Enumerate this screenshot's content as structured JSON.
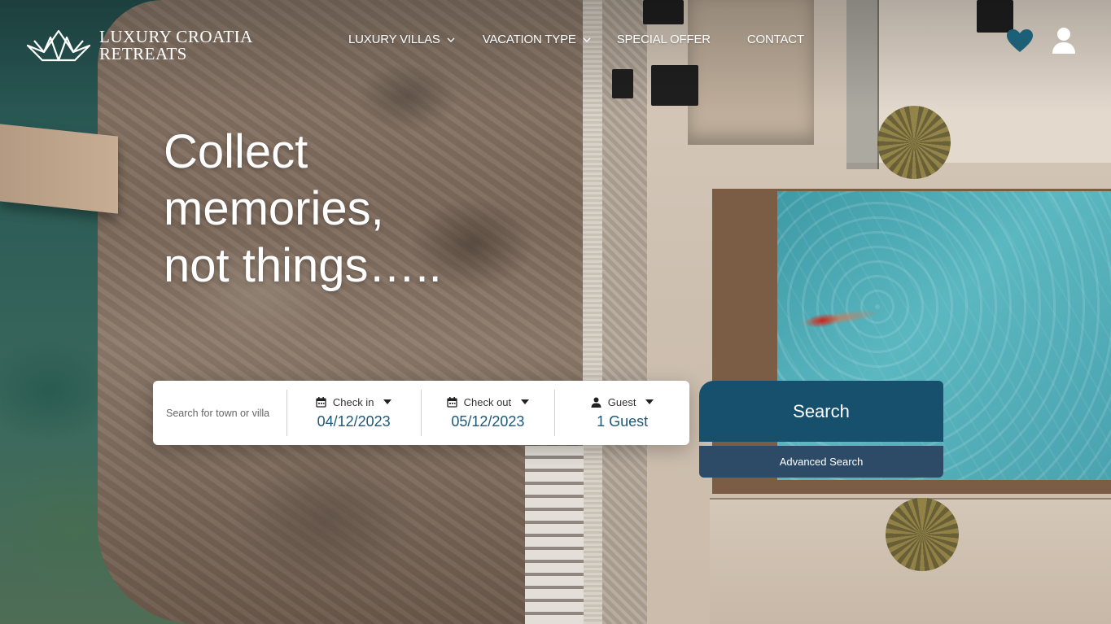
{
  "brand": {
    "name_line1": "LUXURY CROATIA",
    "name_line2": "RETREATS"
  },
  "nav": {
    "items": [
      {
        "label": "LUXURY VILLAS",
        "dropdown": true
      },
      {
        "label": "VACATION TYPE",
        "dropdown": true
      },
      {
        "label": "SPECIAL OFFER",
        "dropdown": false
      },
      {
        "label": "CONTACT",
        "dropdown": false
      }
    ]
  },
  "header_icons": [
    "heart-icon",
    "user-icon"
  ],
  "hero": {
    "title": "Collect\nmemories,\nnot things….."
  },
  "search": {
    "town_placeholder": "Search for town or villa",
    "checkin_label": "Check in",
    "checkin_value": "04/12/2023",
    "checkout_label": "Check out",
    "checkout_value": "05/12/2023",
    "guest_label": "Guest",
    "guest_value": "1 Guest",
    "search_button": "Search",
    "advanced_button": "Advanced Search"
  },
  "colors": {
    "primary": "#16506d",
    "secondary": "#2d4b66",
    "field_value": "#1e5878",
    "heart": "#1e5f78"
  }
}
